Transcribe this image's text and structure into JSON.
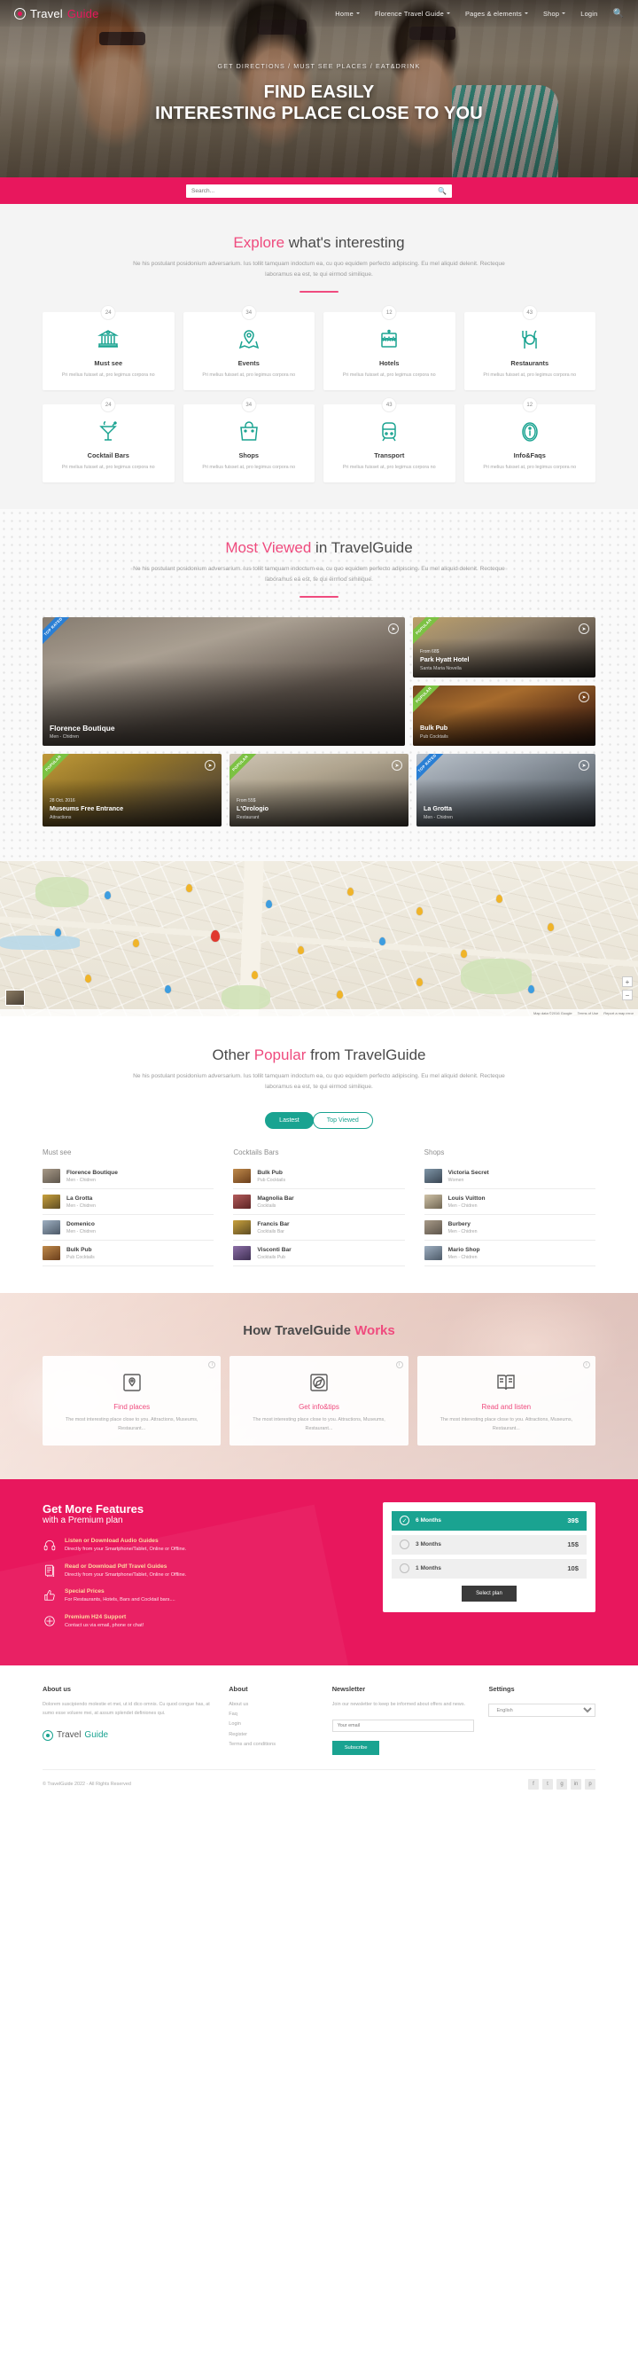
{
  "header": {
    "logo_travel": "Travel",
    "logo_guide": "Guide",
    "nav": [
      {
        "label": "Home",
        "caret": true
      },
      {
        "label": "Florence Travel Guide",
        "caret": true
      },
      {
        "label": "Pages & elements",
        "caret": true
      },
      {
        "label": "Shop",
        "caret": true
      },
      {
        "label": "Login",
        "caret": false
      }
    ],
    "search_icon": "search-icon"
  },
  "hero": {
    "kicker": "GET DIRECTIONS / MUST SEE PLACES / EAT&DRINK",
    "title_line1": "FIND EASILY",
    "title_line2": "INTERESTING PLACE CLOSE TO YOU"
  },
  "search": {
    "placeholder": "Search...",
    "value": ""
  },
  "explore": {
    "title_accent": "Explore",
    "title_rest": " what's interesting",
    "subtitle": "Ne his postulant posidonium adversarium. Ius tollit tamquam indoctum ea, cu quo equidem perfecto adipiscing. Eu mel aliquid delenit. Recteque laboramus ea est, te qui eirmod similique.",
    "categories_row1": [
      {
        "count": "24",
        "name": "Must see",
        "desc": "Pri melius fuisset at, pro legimus corpora no",
        "icon": "museum-icon"
      },
      {
        "count": "34",
        "name": "Events",
        "desc": "Pri melius fuisset at, pro legimus corpora no",
        "icon": "map-pin-icon"
      },
      {
        "count": "12",
        "name": "Hotels",
        "desc": "Pri melius fuisset at, pro legimus corpora no",
        "icon": "hotel-sign-icon"
      },
      {
        "count": "43",
        "name": "Restaurants",
        "desc": "Pri melius fuisset at, pro legimus corpora no",
        "icon": "cutlery-icon"
      }
    ],
    "categories_row2": [
      {
        "count": "24",
        "name": "Cocktail Bars",
        "desc": "Pri melius fuisset at, pro legimus corpora no",
        "icon": "cocktail-icon"
      },
      {
        "count": "34",
        "name": "Shops",
        "desc": "Pri melius fuisset at, pro legimus corpora no",
        "icon": "shopping-bag-icon"
      },
      {
        "count": "43",
        "name": "Transport",
        "desc": "Pri melius fuisset at, pro legimus corpora no",
        "icon": "train-icon"
      },
      {
        "count": "12",
        "name": "Info&Faqs",
        "desc": "Pri melius fuisset at, pro legimus corpora no",
        "icon": "info-icon"
      }
    ]
  },
  "most_viewed": {
    "title_accent": "Most Viewed",
    "title_rest": " in TravelGuide",
    "subtitle": "Ne his postulant posidonium adversarium. Ius tollit tamquam indoctum ea, cu quo equidem perfecto adipiscing. Eu mel aliquid delenit. Recteque laboramus ea est, te qui eirmod similique.",
    "tiles": [
      {
        "ribbon": "TOP RATED",
        "ribbon_color": "blue",
        "name": "Florence Boutique",
        "sub": "Men - Chidren",
        "meta": ""
      },
      {
        "ribbon": "POPULAR",
        "ribbon_color": "green",
        "name": "Park Hyatt Hotel",
        "sub": "Santa Maria Novella",
        "meta": "From 68$"
      },
      {
        "ribbon": "POPULAR",
        "ribbon_color": "green",
        "name": "Bulk Pub",
        "sub": "Pub Cocktails",
        "meta": ""
      },
      {
        "ribbon": "POPULAR",
        "ribbon_color": "green",
        "name": "Museums Free Entrance",
        "sub": "Attractions",
        "meta": "28 Oct. 2016"
      },
      {
        "ribbon": "POPULAR",
        "ribbon_color": "green",
        "name": "L'Orologio",
        "sub": "Restaurant",
        "meta": "From 55$"
      },
      {
        "ribbon": "TOP RATED",
        "ribbon_color": "blue",
        "name": "La Grotta",
        "sub": "Men - Chidren",
        "meta": ""
      }
    ]
  },
  "map": {
    "zoom_in": "+",
    "zoom_out": "−",
    "attribution": "Map data ©2016 Google",
    "terms": "Terms of Use",
    "report": "Report a map error"
  },
  "other_popular": {
    "title_pre": "Other ",
    "title_accent": "Popular",
    "title_rest": " from TravelGuide",
    "subtitle": "Ne his postulant posidonium adversarium. Ius tollit tamquam indoctum ea, cu quo equidem perfecto adipiscing. Eu mel aliquid delenit. Recteque laboramus ea est, te qui eirmod similique.",
    "toggle_on": "Lastest",
    "toggle_off": "Top Viewed",
    "columns": [
      {
        "title": "Must see",
        "items": [
          {
            "name": "Florence Boutique",
            "sub": "Men - Chidren",
            "thumb": "lt1"
          },
          {
            "name": "La Grotta",
            "sub": "Men - Chidren",
            "thumb": "lt4"
          },
          {
            "name": "Domenico",
            "sub": "Men - Chidren",
            "thumb": "lt3"
          },
          {
            "name": "Bulk Pub",
            "sub": "Pub Cocktails",
            "thumb": "lt2"
          }
        ]
      },
      {
        "title": "Cocktails Bars",
        "items": [
          {
            "name": "Bulk Pub",
            "sub": "Pub Cocktails",
            "thumb": "lt2"
          },
          {
            "name": "Magnolia Bar",
            "sub": "Cocktails",
            "thumb": "lt5"
          },
          {
            "name": "Francis Bar",
            "sub": "Cocktails Bar",
            "thumb": "lt4"
          },
          {
            "name": "Visconti Bar",
            "sub": "Cocktails Pub",
            "thumb": "lt8"
          }
        ]
      },
      {
        "title": "Shops",
        "items": [
          {
            "name": "Victoria Secret",
            "sub": "Women",
            "thumb": "lt6"
          },
          {
            "name": "Louis Vuitton",
            "sub": "Men - Chidren",
            "thumb": "lt7"
          },
          {
            "name": "Burbery",
            "sub": "Men - Chidren",
            "thumb": "lt1"
          },
          {
            "name": "Mario Shop",
            "sub": "Men - Chidren",
            "thumb": "lt3"
          }
        ]
      }
    ]
  },
  "works": {
    "title_pre": "How TravelGuide ",
    "title_accent": "Works",
    "cards": [
      {
        "name": "Find places",
        "desc": "The most interesting place close to you. Attractions, Museums, Restaurant...",
        "icon": "map-marker-icon",
        "info": "i"
      },
      {
        "name": "Get info&tips",
        "desc": "The most interesting place close to you. Attractions, Museums, Restaurant...",
        "icon": "compass-icon",
        "info": "i"
      },
      {
        "name": "Read and listen",
        "desc": "The most interesting place close to you. Attractions, Museums, Restaurant...",
        "icon": "book-icon",
        "info": "i"
      }
    ]
  },
  "premium": {
    "heading1": "Get More Features",
    "heading2": "with a Premium plan",
    "features": [
      {
        "title": "Listen or Download Audio Guides",
        "desc": "Directly from your Smartphone/Tablet, Online or Offline.",
        "icon": "headphones-icon"
      },
      {
        "title": "Read or Download Pdf Travel Guides",
        "desc": "Directly from your Smartphone/Tablet, Online or Offline.",
        "icon": "document-icon"
      },
      {
        "title": "Special Prices",
        "desc": "For Restaurants, Hotels, Bars and Cocktail bars....",
        "icon": "thumbs-up-icon"
      },
      {
        "title": "Premium H24 Support",
        "desc": "Contact us via email, phone or chat!",
        "icon": "support-icon"
      }
    ],
    "plans": [
      {
        "label": "6 Months",
        "price": "39$",
        "selected": true
      },
      {
        "label": "3 Months",
        "price": "15$",
        "selected": false
      },
      {
        "label": "1 Months",
        "price": "10$",
        "selected": false
      }
    ],
    "select_button": "Select plan"
  },
  "footer": {
    "about_us": {
      "title": "About us",
      "text": "Dolorem suscipiendo molestie et mei, ut id dico omnis. Cu quod congue has, at sumo esse voluere mei, at assum splendet definiones qui."
    },
    "about": {
      "title": "About",
      "links": [
        "About us",
        "Faq",
        "Login",
        "Register",
        "Terms and conditions"
      ]
    },
    "newsletter": {
      "title": "Newsletter",
      "desc": "Join our newsletter to keep be informed about offers and news.",
      "placeholder": "Your email",
      "button": "Subscribe"
    },
    "settings": {
      "title": "Settings",
      "language": "English"
    },
    "logo_travel": "Travel",
    "logo_guide": "Guide",
    "copyright": "© TravelGuide 2022 - All Rights Reserved",
    "socials": [
      "f",
      "t",
      "g",
      "in",
      "p"
    ]
  }
}
